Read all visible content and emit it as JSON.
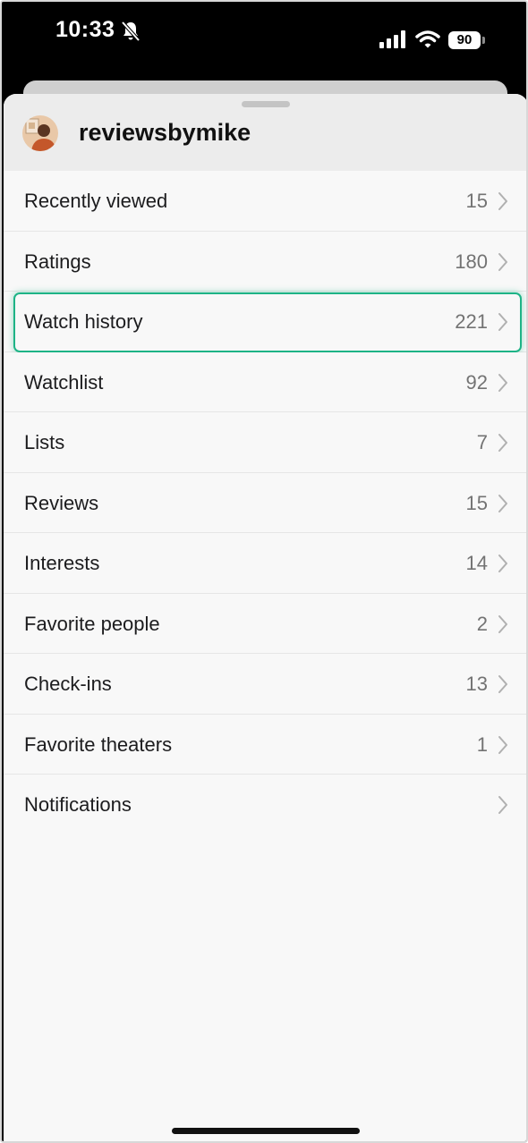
{
  "status_bar": {
    "time": "10:33",
    "battery": "90",
    "icons": [
      "bell-slash-icon",
      "cellular-signal-icon",
      "wifi-icon",
      "battery-icon"
    ]
  },
  "profile": {
    "username": "reviewsbymike",
    "avatar_icon": "avatar"
  },
  "menu": {
    "items": [
      {
        "label": "Recently viewed",
        "count": "15"
      },
      {
        "label": "Ratings",
        "count": "180"
      },
      {
        "label": "Watch history",
        "count": "221"
      },
      {
        "label": "Watchlist",
        "count": "92"
      },
      {
        "label": "Lists",
        "count": "7"
      },
      {
        "label": "Reviews",
        "count": "15"
      },
      {
        "label": "Interests",
        "count": "14"
      },
      {
        "label": "Favorite people",
        "count": "2"
      },
      {
        "label": "Check-ins",
        "count": "13"
      },
      {
        "label": "Favorite theaters",
        "count": "1"
      },
      {
        "label": "Notifications",
        "count": ""
      }
    ],
    "chevron_icon": "chevron-right-icon",
    "highlight_color": "#1db386"
  }
}
